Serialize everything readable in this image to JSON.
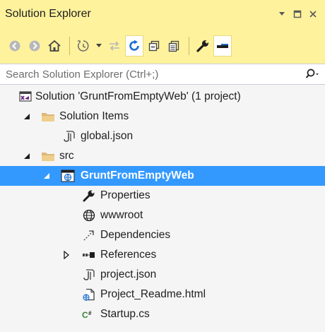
{
  "window": {
    "title": "Solution Explorer",
    "menu_glyph": "▾",
    "restore_glyph": "□",
    "close_glyph": "×"
  },
  "toolbar": {
    "items": [
      "back-icon",
      "forward-icon",
      "home-icon",
      "pending-changes-filter-icon",
      "dropdown-arrow-icon",
      "sync-with-active-document-icon",
      "refresh-icon",
      "collapse-all-icon",
      "show-all-files-icon",
      "properties-icon",
      "preview-selected-items-icon"
    ]
  },
  "search": {
    "placeholder": "Search Solution Explorer (Ctrl+;)",
    "value": ""
  },
  "tree": {
    "items": [
      {
        "label": "Solution 'GruntFromEmptyWeb' (1 project)",
        "icon": "solution-icon",
        "level": 0,
        "expander": "none"
      },
      {
        "label": "Solution Items",
        "icon": "folder-icon",
        "level": 1,
        "expander": "expanded"
      },
      {
        "label": "global.json",
        "icon": "json-file-icon",
        "level": 2,
        "expander": "none"
      },
      {
        "label": "src",
        "icon": "folder-icon",
        "level": 1,
        "expander": "expanded"
      },
      {
        "label": "GruntFromEmptyWeb",
        "icon": "web-project-icon",
        "level": 2,
        "expander": "expanded",
        "selected": true
      },
      {
        "label": "Properties",
        "icon": "wrench-icon",
        "level": 3,
        "expander": "none"
      },
      {
        "label": "wwwroot",
        "icon": "globe-icon",
        "level": 3,
        "expander": "none"
      },
      {
        "label": "Dependencies",
        "icon": "dependencies-icon",
        "level": 3,
        "expander": "none"
      },
      {
        "label": "References",
        "icon": "references-icon",
        "level": 3,
        "expander": "collapsed"
      },
      {
        "label": "project.json",
        "icon": "json-file-icon",
        "level": 3,
        "expander": "none"
      },
      {
        "label": "Project_Readme.html",
        "icon": "html-file-icon",
        "level": 3,
        "expander": "none"
      },
      {
        "label": "Startup.cs",
        "icon": "csharp-file-icon",
        "level": 3,
        "expander": "none"
      }
    ]
  },
  "colors": {
    "title_bar": "#fff29d",
    "selection": "#3399ff",
    "background": "#f5f5f5"
  }
}
